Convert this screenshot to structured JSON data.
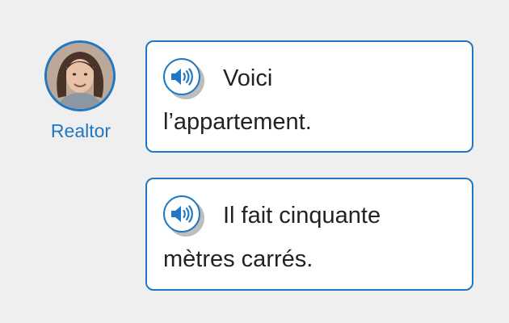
{
  "speaker": {
    "label": "Realtor",
    "avatar_icon": "woman-portrait"
  },
  "messages": [
    {
      "lines": [
        "Voici",
        "l’appartement."
      ],
      "audio_icon": "speaker-icon"
    },
    {
      "lines": [
        "Il fait cinquante",
        "mètres carrés."
      ],
      "audio_icon": "speaker-icon"
    }
  ],
  "colors": {
    "accent": "#1f78c1",
    "background": "#efefef",
    "bubble": "#ffffff",
    "text": "#222222"
  }
}
